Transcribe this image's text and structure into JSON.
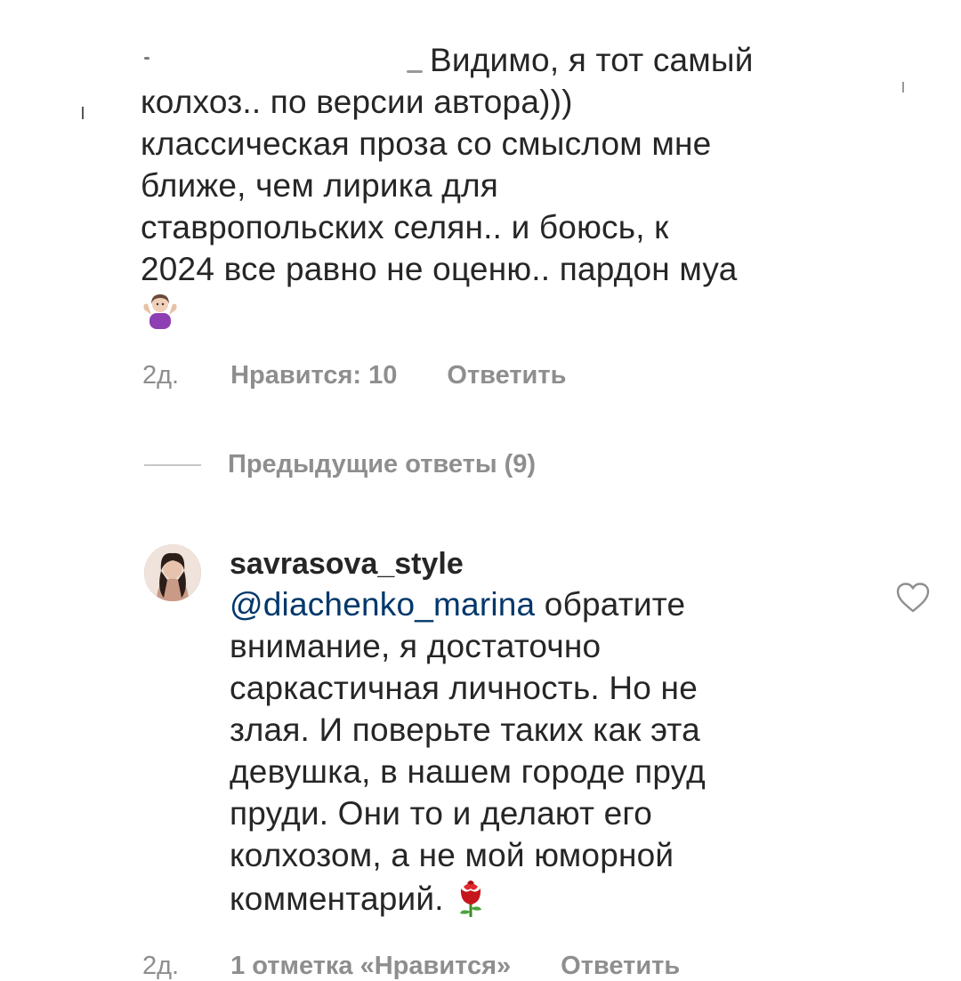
{
  "top_comment": {
    "first_line_text": "Видимо, я тот самый",
    "lines": [
      "колхоз.. по версии автора)))",
      "классическая проза со смыслом мне",
      "ближе, чем лирика для",
      "ставропольских селян.. и боюсь, к",
      "2024 все равно не оценю.. пардон муа"
    ],
    "emoji": "woman-shrugging-emoji",
    "meta": {
      "time": "2д.",
      "likes": "Нравится: 10",
      "reply": "Ответить"
    }
  },
  "previous_replies": "Предыдущие ответы (9)",
  "reply": {
    "username": "savrasova_style",
    "mention": "@diachenko_marina",
    "first_line_rest": " обратите",
    "lines": [
      "внимание, я достаточно",
      "саркастичная личность. Но не",
      "злая. И поверьте таких как эта",
      "девушка, в нашем городе пруд",
      "пруди. Они то и делают его",
      "колхозом, а не мой юморной"
    ],
    "last_line": "комментарий. ",
    "emoji": "rose-emoji",
    "meta": {
      "time": "2д.",
      "likes": "1 отметка «Нравится»",
      "reply": "Ответить"
    }
  },
  "icons": {
    "like": "heart-icon"
  },
  "colors": {
    "text": "#262626",
    "secondary": "#8e8e8e",
    "mention": "#00376b",
    "divider": "#c7c7c7"
  }
}
